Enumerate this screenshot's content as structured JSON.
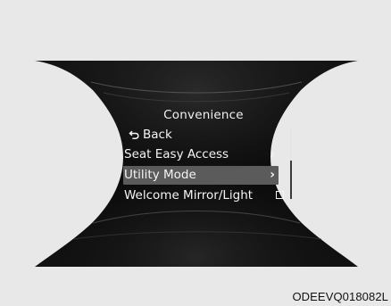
{
  "display": {
    "title": "Convenience",
    "items": [
      {
        "label": "Back",
        "icon": "back-arrow-icon",
        "selected": false
      },
      {
        "label": "Seat Easy Access",
        "icon": "chevron-right-icon",
        "selected": false
      },
      {
        "label": "Utility Mode",
        "icon": "chevron-right-icon",
        "selected": true
      },
      {
        "label": "Welcome Mirror/Light",
        "icon": "checkbox-unchecked-icon",
        "selected": false
      }
    ]
  },
  "scrollbar": {
    "visible_fraction": 0.48,
    "position": 0
  },
  "image_code": "ODEEVQ018082L",
  "colors": {
    "panel": "#0c0c0c",
    "background": "#e8e8e8",
    "text": "#f4f4f4",
    "selection": "#5b5b5b",
    "line": "#6a6a6a"
  }
}
